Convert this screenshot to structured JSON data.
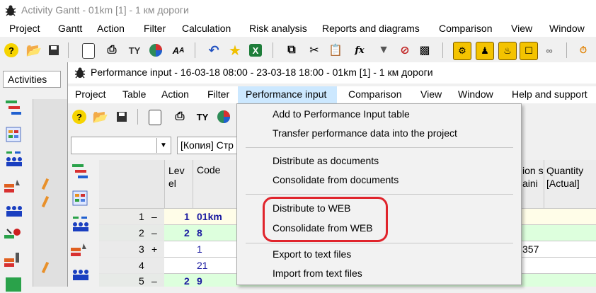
{
  "outer_window": {
    "title": "Activity Gantt - 01km [1] - 1 км дороги",
    "menu": [
      "Project",
      "Gantt",
      "Action",
      "Filter",
      "Calculation",
      "Risk analysis",
      "Reports and diagrams",
      "Comparison",
      "View",
      "Window"
    ],
    "activities_combo": "Activities"
  },
  "inner_window": {
    "title": "Performance input - 16-03-18  08:00 - 23-03-18  18:00 - 01km [1] - 1 км дороги",
    "menu": [
      "Project",
      "Table",
      "Action",
      "Filter",
      "Performance input",
      "Comparison",
      "View",
      "Window",
      "Help and support"
    ],
    "combo1_value": "",
    "combo2_value": "[Копия] Стр"
  },
  "grid": {
    "headers": {
      "level": "Lev el",
      "code": "Code",
      "partial": "ion s aini",
      "quantity": "Quantity [Actual]"
    },
    "rows": [
      {
        "index": "1",
        "expander": "–",
        "level": "1",
        "code": "01km",
        "partial": "",
        "quantity": ""
      },
      {
        "index": "2",
        "expander": "–",
        "level": "2",
        "code": "8",
        "partial": "",
        "quantity": ""
      },
      {
        "index": "3",
        "expander": "+",
        "level": "",
        "code": "1",
        "partial": "357",
        "quantity": ""
      },
      {
        "index": "4",
        "expander": "",
        "level": "",
        "code": "21",
        "partial": "",
        "quantity": ""
      },
      {
        "index": "5",
        "expander": "–",
        "level": "2",
        "code": "9",
        "partial": "",
        "quantity": ""
      }
    ]
  },
  "dropdown": {
    "items": [
      "Add to Performance Input table",
      "Transfer performance data into the project",
      "Distribute as documents",
      "Consolidate from documents",
      "Distribute to WEB",
      "Consolidate from WEB",
      "Export to text files",
      "Import from text files"
    ]
  },
  "colors": {
    "highlight": "#e0242c",
    "menu_open": "#cce8ff",
    "row_green": "#ddffdd"
  }
}
